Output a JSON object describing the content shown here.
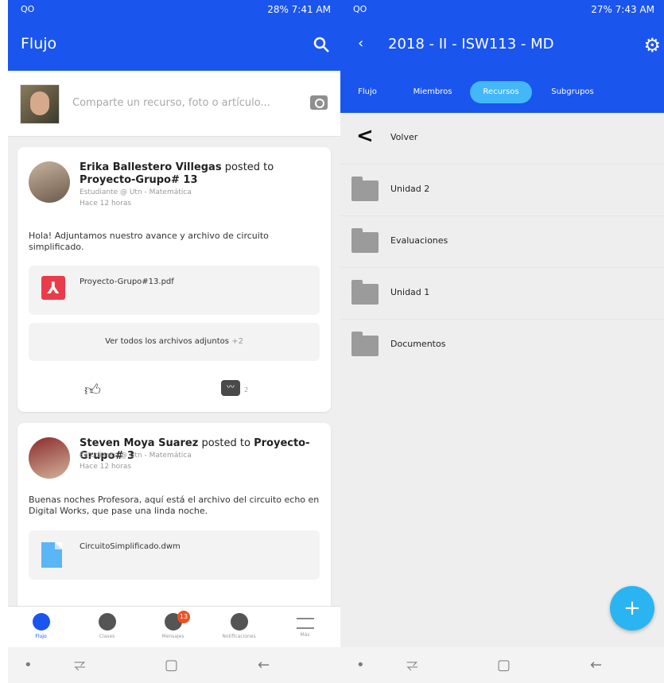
{
  "left": {
    "status": {
      "left": "QO",
      "right": "28% 7:41 AM"
    },
    "appbar": {
      "title": "Flujo"
    },
    "composer": {
      "placeholder": "Comparte un recurso, foto o artículo..."
    },
    "posts": [
      {
        "author": "Erika Ballestero Villegas",
        "posted_to": "posted to",
        "group": "Proyecto-Grupo# 13",
        "subtitle": "Estudiante @ Utn - Matemática",
        "time": "Hace 12 horas",
        "text": "Hola! Adjuntamos nuestro avance y archivo de circuito simplificado.",
        "file": "Proyecto-Grupo#13.pdf",
        "all_files_label": "Ver todos los archivos adjuntos",
        "all_files_count": "+2",
        "comment_count": "2"
      },
      {
        "author": "Steven Moya Suarez",
        "posted_to": "posted to",
        "group": "Proyecto-Grupo# 3",
        "subtitle": "Estudiante @ Utn - Matemática",
        "time": "Hace 12 horas",
        "text": "Buenas noches Profesora, aquí está el archivo del circuito echo en Digital Works, que pase una linda noche.",
        "file": "CircuitoSimplificado.dwm"
      }
    ],
    "bottom_nav": [
      {
        "label": "Flujo"
      },
      {
        "label": "Clases"
      },
      {
        "label": "Mensajes",
        "badge": "13"
      },
      {
        "label": "Notificaciones"
      },
      {
        "label": "Más"
      }
    ]
  },
  "right": {
    "status": {
      "left": "QO",
      "right": "27% 7:43 AM"
    },
    "title": "2018 - II - ISW113 - MD",
    "tabs": [
      "Flujo",
      "Miembros",
      "Recursos",
      "Subgrupos"
    ],
    "back_label": "Volver",
    "folders": [
      "Unidad 2",
      "Evaluaciones",
      "Unidad 1",
      "Documentos"
    ],
    "fab_label": "+"
  },
  "colors": {
    "primary": "#1a55ee",
    "accent": "#43b7f7",
    "fab": "#2bb4f2",
    "badge": "#f05022"
  },
  "icons": [
    "search-icon",
    "camera-icon",
    "like-icon",
    "comment-icon",
    "pdf-icon",
    "document-icon",
    "folder-icon",
    "gear-icon",
    "back-chevron-icon",
    "home-icon"
  ]
}
